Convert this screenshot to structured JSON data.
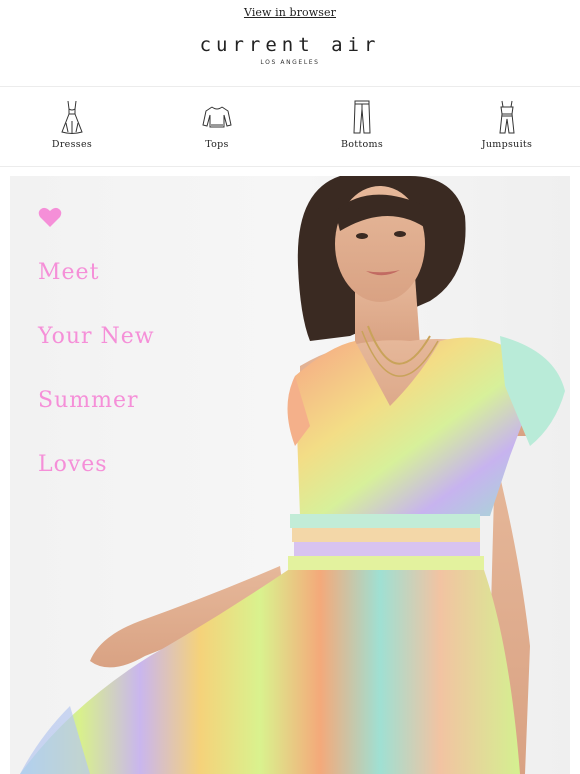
{
  "topbar": {
    "view_in_browser": "View in browser"
  },
  "brand": {
    "name": "current air",
    "location": "LOS ANGELES"
  },
  "categories": [
    {
      "label": "Dresses",
      "icon": "dress-icon"
    },
    {
      "label": "Tops",
      "icon": "top-icon"
    },
    {
      "label": "Bottoms",
      "icon": "pants-icon"
    },
    {
      "label": "Jumpsuits",
      "icon": "jumpsuit-icon"
    }
  ],
  "hero": {
    "icon": "heart-icon",
    "lines": [
      "Meet",
      "Your New",
      "Summer",
      "Loves"
    ],
    "text_color": "#f58fd8"
  }
}
